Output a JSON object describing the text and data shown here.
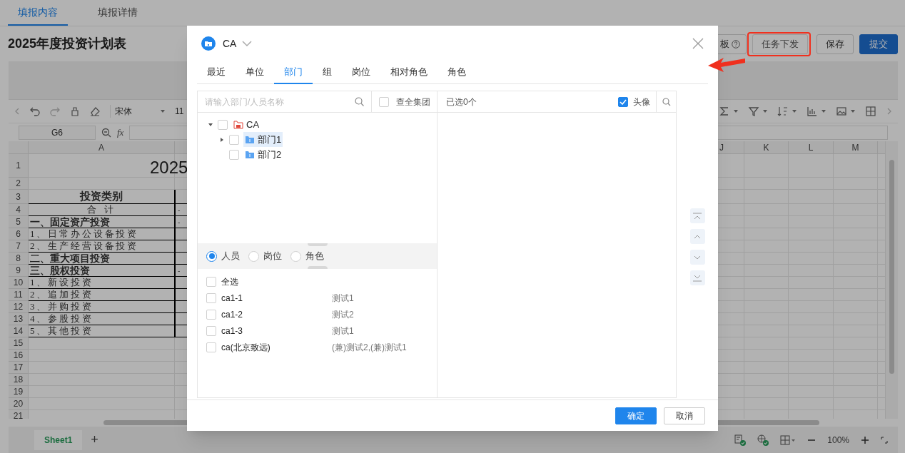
{
  "page_tabs": [
    {
      "label": "填报内容",
      "selected": true
    },
    {
      "label": "填报详情",
      "selected": false
    }
  ],
  "title": "2025年度投资计划表",
  "header_buttons": [
    {
      "label": "板",
      "kind": "help",
      "highlighted": false
    },
    {
      "label": "任务下发",
      "kind": "default",
      "highlighted": true
    },
    {
      "label": "保存",
      "kind": "default",
      "highlighted": false
    },
    {
      "label": "提交",
      "kind": "primary",
      "highlighted": false
    }
  ],
  "spreadsheet": {
    "font": "宋体",
    "font_size": "11",
    "name_box": "G6",
    "formula_label": "fx",
    "columns_left": [
      "A"
    ],
    "columns_right": [
      "J",
      "K",
      "L",
      "M"
    ],
    "rows": [
      {
        "number": "1",
        "kind": "title",
        "a": "2025"
      },
      {
        "number": "2",
        "kind": "blank"
      },
      {
        "number": "3",
        "kind": "header",
        "a": "投资类别"
      },
      {
        "number": "4",
        "kind": "total",
        "a": "合 计",
        "b": "-"
      },
      {
        "number": "5",
        "kind": "section",
        "a": "一、固定资产投资",
        "b": "-"
      },
      {
        "number": "6",
        "kind": "item",
        "a": "1、日常办公设备投资"
      },
      {
        "number": "7",
        "kind": "item",
        "a": "2、生产经营设备投资"
      },
      {
        "number": "8",
        "kind": "section",
        "a": "二、重大项目投资"
      },
      {
        "number": "9",
        "kind": "section",
        "a": "三、股权投资",
        "b": "-"
      },
      {
        "number": "10",
        "kind": "item",
        "a": "1、新设投资"
      },
      {
        "number": "11",
        "kind": "item",
        "a": "2、追加投资"
      },
      {
        "number": "12",
        "kind": "item",
        "a": "3、并购投资"
      },
      {
        "number": "13",
        "kind": "item",
        "a": "4、参股投资"
      },
      {
        "number": "14",
        "kind": "item",
        "a": "5、其他投资"
      },
      {
        "number": "15",
        "kind": "blank"
      },
      {
        "number": "16",
        "kind": "blank"
      },
      {
        "number": "17",
        "kind": "blank"
      },
      {
        "number": "18",
        "kind": "blank"
      },
      {
        "number": "19",
        "kind": "blank"
      },
      {
        "number": "20",
        "kind": "blank"
      },
      {
        "number": "21",
        "kind": "blank"
      }
    ],
    "sheet_tabs": [
      {
        "label": "Sheet1",
        "selected": true
      }
    ],
    "add_sheet": "+",
    "zoom": "100%"
  },
  "modal": {
    "org": "CA",
    "tabs": [
      {
        "label": "最近",
        "selected": false
      },
      {
        "label": "单位",
        "selected": false
      },
      {
        "label": "部门",
        "selected": true
      },
      {
        "label": "组",
        "selected": false
      },
      {
        "label": "岗位",
        "selected": false
      },
      {
        "label": "相对角色",
        "selected": false
      },
      {
        "label": "角色",
        "selected": false
      }
    ],
    "search": {
      "placeholder": "请输入部门/人员名称"
    },
    "whole_group": {
      "label": "查全集团",
      "checked": false
    },
    "selected_count": "已选0个",
    "avatar": {
      "label": "头像",
      "checked": true
    },
    "tree": [
      {
        "label": "CA",
        "kind": "org",
        "expanded": true,
        "checked": false,
        "selected": false,
        "children": [
          {
            "label": "部门1",
            "kind": "dept",
            "expanded": false,
            "checked": false,
            "selected": true
          },
          {
            "label": "部门2",
            "kind": "dept",
            "checked": false,
            "selected": false
          }
        ]
      }
    ],
    "member_types": [
      {
        "label": "人员",
        "selected": true
      },
      {
        "label": "岗位",
        "selected": false
      },
      {
        "label": "角色",
        "selected": false
      }
    ],
    "select_all": {
      "label": "全选",
      "checked": false
    },
    "members": [
      {
        "name": "ca1-1",
        "post": "测试1",
        "checked": false
      },
      {
        "name": "ca1-2",
        "post": "测试2",
        "checked": false
      },
      {
        "name": "ca1-3",
        "post": "测试1",
        "checked": false
      },
      {
        "name": "ca(北京致远)",
        "post": "(兼)测试2,(兼)测试1",
        "checked": false
      }
    ],
    "buttons": [
      {
        "label": "确定",
        "kind": "primary"
      },
      {
        "label": "取消",
        "kind": "default"
      }
    ]
  }
}
